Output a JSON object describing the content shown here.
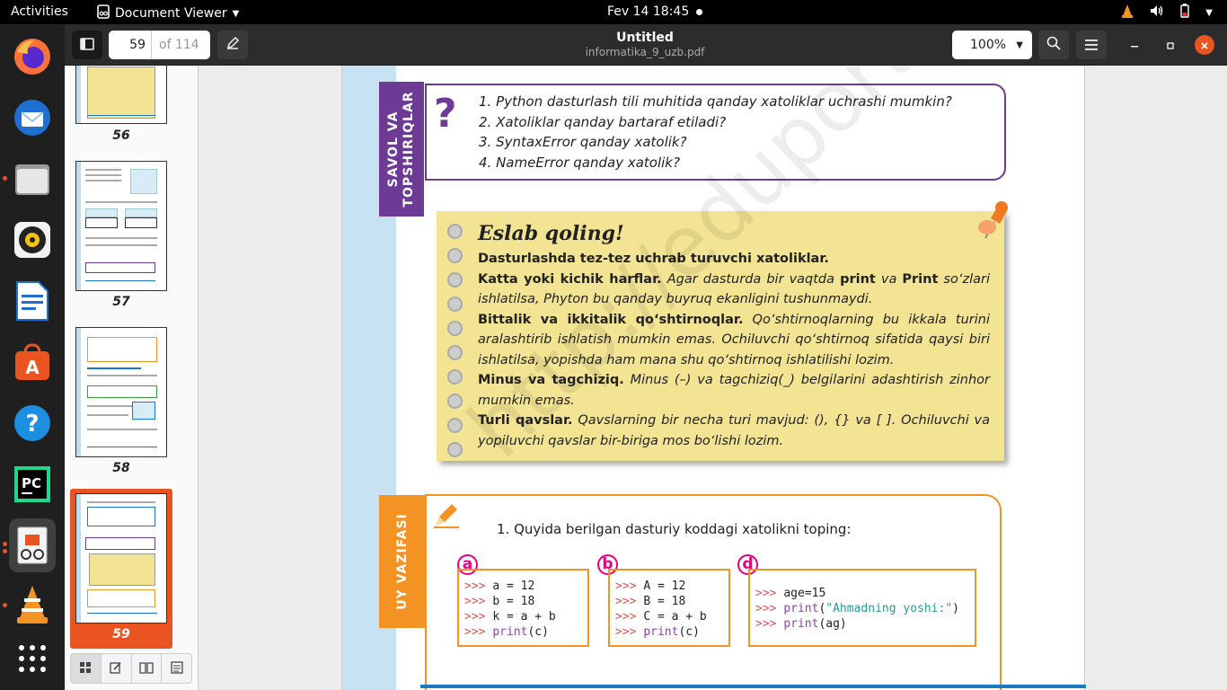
{
  "topbar": {
    "activities": "Activities",
    "app_name": "Document Viewer",
    "clock": "Fev 14  18:45"
  },
  "header": {
    "page_number": "59",
    "page_total": "of 114",
    "title": "Untitled",
    "filename": "informatika_9_uzb.pdf",
    "zoom": "100%"
  },
  "sidebar": {
    "thumbs": [
      {
        "label": "56"
      },
      {
        "label": "57"
      },
      {
        "label": "58"
      },
      {
        "label": "59"
      }
    ]
  },
  "page": {
    "savol_tab": "SAVOL VA TOPSHIRIQLAR",
    "questions": [
      "1. Python dasturlash tili muhitida qanday xatoliklar uchrashi mumkin?",
      "2. Xatoliklar qanday bartaraf etiladi?",
      "3. SyntaxError qanday xatolik?",
      "4. NameError qanday xatolik?"
    ],
    "eslab_title": "Eslab qoling!",
    "eslab_intro": "Dasturlashda tez-tez uchrab turuvchi xatoliklar.",
    "eslab_items": [
      {
        "head": "Katta yoki kichik harflar.",
        "t1": " Agar dasturda bir vaqtda ",
        "b1": "print",
        "t2": " va ",
        "b2": "Print",
        "t3": " so‘zlari ishlatilsa, Phyton bu qanday buyruq ekanligini tushunmaydi."
      },
      {
        "head": "Bittalik va ikkitalik qo‘shtirnoqlar.",
        "text": " Qo‘shtirnoqlarning bu ikkala turini aralashtirib ishlatish mumkin emas. Ochiluvchi qo‘shtirnoq sifatida qaysi biri ishlatilsa, yopishda ham mana shu qo‘shtirnoq ishlatilishi lozim."
      },
      {
        "head": "Minus va tagchiziq.",
        "text": " Minus (–) va tagchiziq(_) belgilarini adashtirish zinhor mumkin emas."
      },
      {
        "head": "Turli qavslar.",
        "text": " Qavslarning bir necha turi mavjud: (), {} va [ ]. Ochiluvchi va yopiluvchi qavslar bir-biriga mos bo‘lishi lozim."
      }
    ],
    "uy_tab": "UY VAZIFASI",
    "uy_task": "1. Quyida berilgan dasturiy koddagi xatolikni toping:",
    "code_a_label": "a",
    "code_b_label": "b",
    "code_d_label": "d",
    "prompt": ">>>",
    "code_a": [
      "a = 12",
      "b = 18",
      "k = a + b"
    ],
    "code_a_last": {
      "fn": "print",
      "arg": "(c)"
    },
    "code_b": [
      "A = 12",
      "B = 18",
      "C = a + b"
    ],
    "code_b_last": {
      "fn": "print",
      "arg": "(c)"
    },
    "code_d": {
      "l1": "age=15",
      "l2_fn": "print",
      "l2_open": "(",
      "l2_str": "\"Ahmadning yoshi:\"",
      "l2_close": ")",
      "l3_fn": "print",
      "l3_arg": "(ag)"
    },
    "watermark": "http://eduportal.uz"
  },
  "colors": {
    "accent": "#e95420",
    "savol": "#6d3b96",
    "uy": "#f39323",
    "note_bg": "#f2e493",
    "code_label": "#e6007e"
  }
}
